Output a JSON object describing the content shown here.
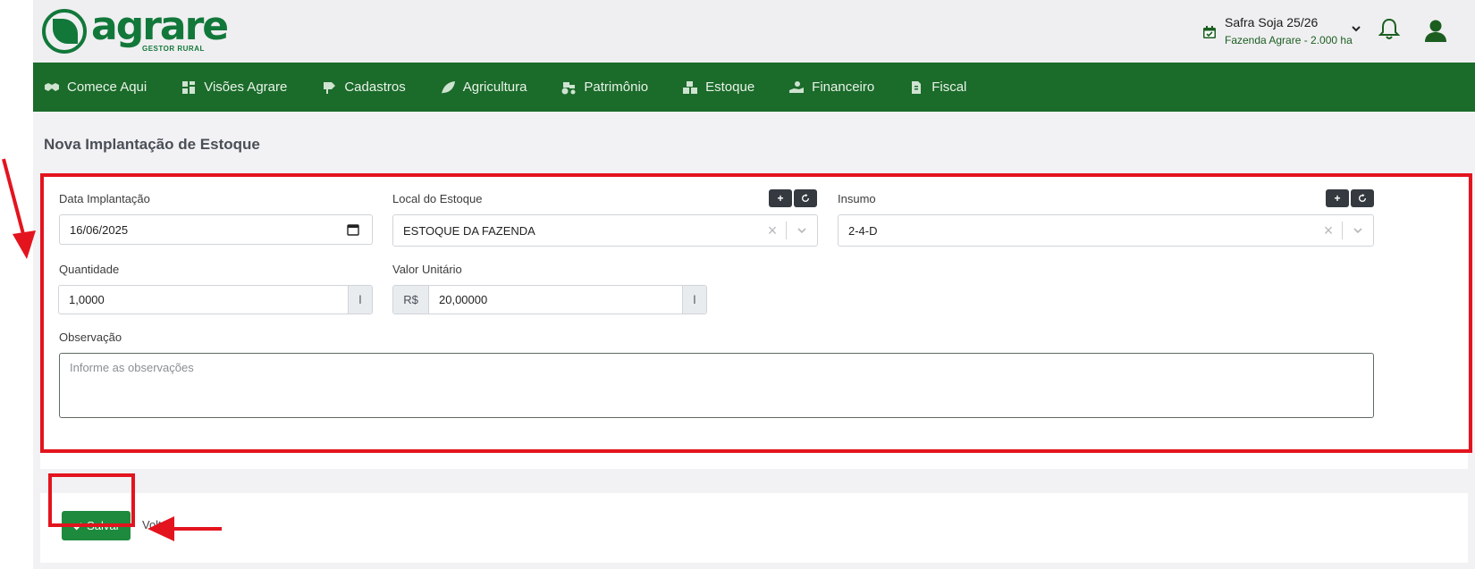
{
  "header": {
    "logo_name": "agrare",
    "logo_sub": "GESTOR RURAL",
    "safra_title": "Safra Soja 25/26",
    "safra_subtitle": "Fazenda Agrare - 2.000 ha"
  },
  "nav": {
    "items": [
      {
        "label": "Comece Aqui",
        "icon": "handshake-icon"
      },
      {
        "label": "Visões Agrare",
        "icon": "dashboard-icon"
      },
      {
        "label": "Cadastros",
        "icon": "sign-icon"
      },
      {
        "label": "Agricultura",
        "icon": "leaf-icon"
      },
      {
        "label": "Patrimônio",
        "icon": "tractor-icon"
      },
      {
        "label": "Estoque",
        "icon": "boxes-icon"
      },
      {
        "label": "Financeiro",
        "icon": "hand-money-icon"
      },
      {
        "label": "Fiscal",
        "icon": "invoice-icon"
      }
    ]
  },
  "page": {
    "title": "Nova Implantação de Estoque"
  },
  "form": {
    "data_label": "Data Implantação",
    "data_value": "16/06/2025",
    "local_label": "Local do Estoque",
    "local_value": "ESTOQUE DA FAZENDA",
    "insumo_label": "Insumo",
    "insumo_value": "2-4-D",
    "quantidade_label": "Quantidade",
    "quantidade_value": "1,0000",
    "quantidade_unit": "l",
    "valor_label": "Valor Unitário",
    "valor_prefix": "R$",
    "valor_value": "20,00000",
    "valor_unit": "l",
    "obs_label": "Observação",
    "obs_placeholder": "Informe as observações",
    "add_symbol": "+",
    "clear_symbol": "×"
  },
  "actions": {
    "save_label": "Salvar",
    "back_label": "Voltar"
  },
  "colors": {
    "brand_green": "#1b6b2a",
    "save_green": "#1d8a3d",
    "highlight_red": "#e3141e"
  }
}
